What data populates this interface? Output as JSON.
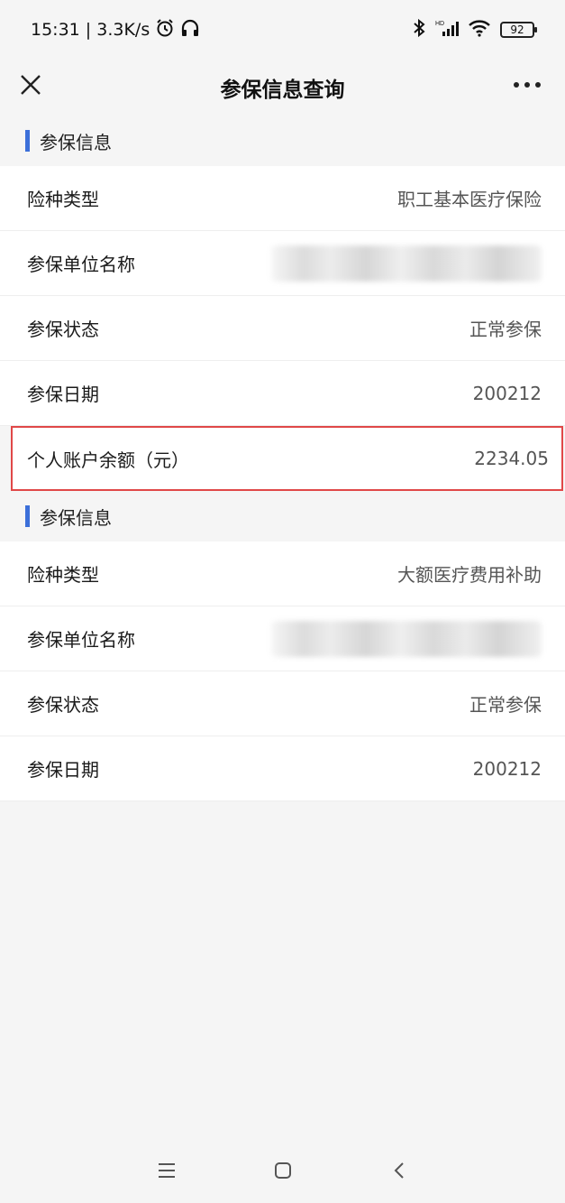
{
  "status_bar": {
    "time_speed": "15:31 | 3.3K/s",
    "icons": [
      "alarm-icon",
      "headset-icon",
      "bluetooth-icon",
      "signal-icon",
      "wifi-icon"
    ],
    "battery": "92"
  },
  "nav": {
    "title": "参保信息查询",
    "close_icon": "close-icon",
    "more_icon": "more-icon"
  },
  "sections": [
    {
      "header": "参保信息",
      "rows": [
        {
          "label": "险种类型",
          "value": "职工基本医疗保险"
        },
        {
          "label": "参保单位名称",
          "value": ""
        },
        {
          "label": "参保状态",
          "value": "正常参保"
        },
        {
          "label": "参保日期",
          "value": "200212"
        },
        {
          "label": "个人账户余额（元）",
          "value": "2234.05"
        }
      ]
    },
    {
      "header": "参保信息",
      "rows": [
        {
          "label": "险种类型",
          "value": "大额医疗费用补助"
        },
        {
          "label": "参保单位名称",
          "value": ""
        },
        {
          "label": "参保状态",
          "value": "正常参保"
        },
        {
          "label": "参保日期",
          "value": "200212"
        }
      ]
    }
  ],
  "highlight_color": "#e04848",
  "accent_color": "#3c6fd9",
  "system_nav": [
    "menu-icon",
    "home-icon",
    "back-icon"
  ]
}
